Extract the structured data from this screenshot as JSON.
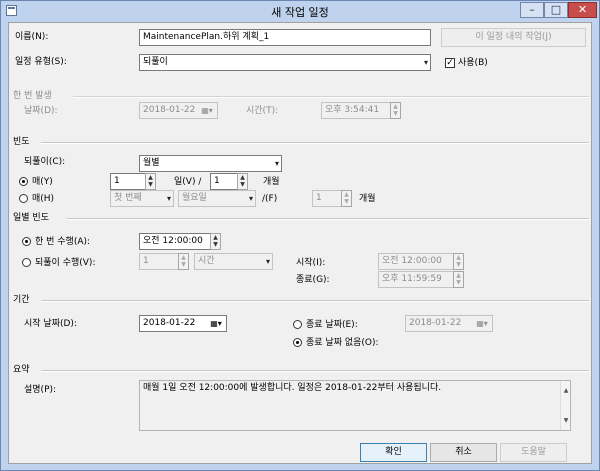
{
  "window": {
    "title": "새 작업 일정",
    "minimize": "–",
    "maximize": "□",
    "close": "✕"
  },
  "name": {
    "label": "이름(N):",
    "value": "MaintenancePlan.하위 계획_1",
    "jobs_button": "이 일정 내의 작업(J)"
  },
  "schedule_type": {
    "label": "일정 유형(S):",
    "value": "되풀이",
    "enabled_label": "사용(B)",
    "enabled_checked": true
  },
  "one_time": {
    "section": "한 번 발생",
    "date_label": "날짜(D):",
    "date_value": "2018-01-22",
    "time_label": "시간(T):",
    "time_value": "오후  3:54:41"
  },
  "frequency": {
    "section": "빈도",
    "recurs_label": "되풀이(C):",
    "recurs_value": "월별",
    "every_day_label": "매(Y)",
    "day_value": "1",
    "day_suffix": "일(V) /",
    "month_value": "1",
    "month_suffix": "개월",
    "the_label": "매(H)",
    "ordinal_value": "첫 번째",
    "weekday_value": "월요일",
    "the_every_suffix": "/(F)",
    "the_month_value": "1",
    "the_month_suffix": "개월"
  },
  "daily": {
    "section": "일별 빈도",
    "once_label": "한 번 수행(A):",
    "once_value": "오전 12:00:00",
    "every_label": "되풀이 수행(V):",
    "every_value": "1",
    "unit_value": "시간",
    "start_label": "시작(I):",
    "start_value": "오전 12:00:00",
    "end_label": "종료(G):",
    "end_value": "오후 11:59:59"
  },
  "duration": {
    "section": "기간",
    "start_date_label": "시작 날짜(D):",
    "start_date_value": "2018-01-22",
    "end_date_label": "종료 날짜(E):",
    "end_date_value": "2018-01-22",
    "no_end_label": "종료 날짜 없음(O):"
  },
  "summary": {
    "section": "요약",
    "description_label": "설명(P):",
    "description_value": "매월 1일 오전 12:00:00에 발생합니다. 일정은 2018-01-22부터 사용됩니다."
  },
  "buttons": {
    "ok": "확인",
    "cancel": "취소",
    "help": "도움말"
  },
  "icons": {
    "calendar": "▦▾",
    "dropdown": "▾",
    "spin_up": "▲",
    "spin_down": "▼",
    "check": "✓"
  }
}
